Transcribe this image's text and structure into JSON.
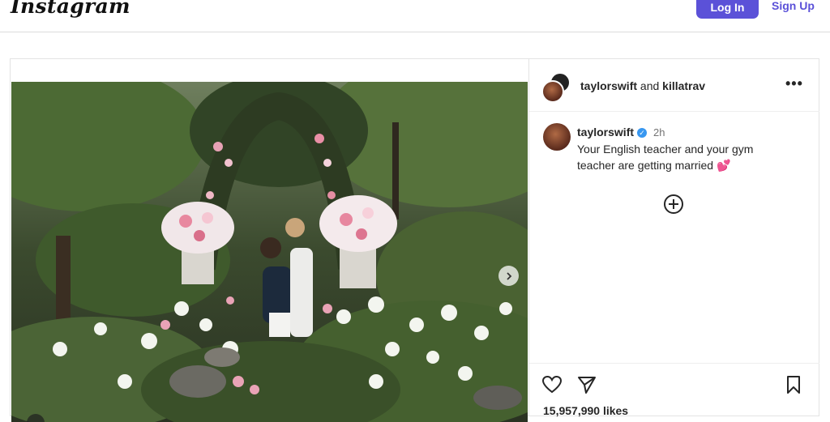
{
  "header": {
    "logo_text": "Instagram",
    "login_label": "Log In",
    "signup_label": "Sign Up"
  },
  "post": {
    "media_alt": "Couple embracing in a garden surrounded by white and pink flowers",
    "author": "taylorswift",
    "coauthor_joiner": "and",
    "coauthor": "killatrav",
    "more_icon": "more-horizontal-icon",
    "caption_user": "taylorswift",
    "verified_icon": "verified-badge-icon",
    "time": "2h",
    "caption_text": "Your English teacher and your gym teacher are getting married 💕",
    "likes": "15,957,990 likes",
    "icons": {
      "like": "heart-icon",
      "share": "send-icon",
      "save": "bookmark-icon",
      "add": "add-comment-icon",
      "next": "chevron-right-icon"
    }
  }
}
